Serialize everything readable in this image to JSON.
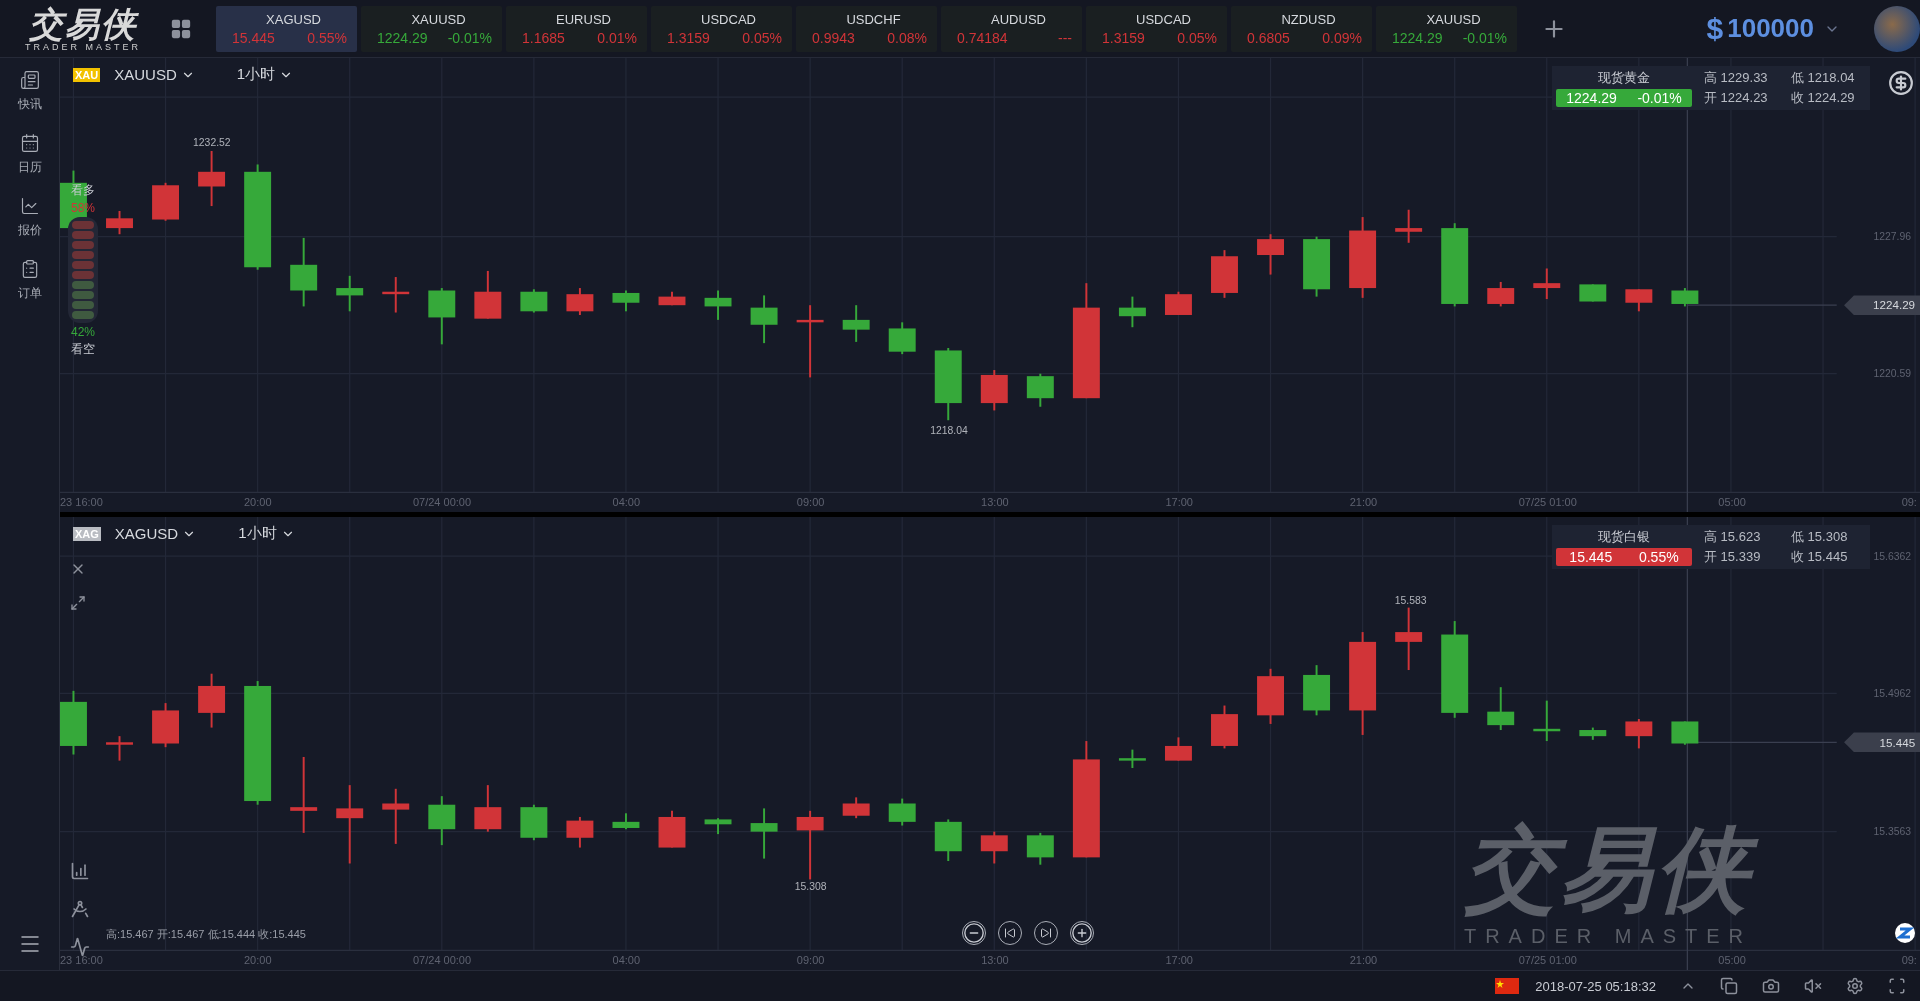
{
  "logo": {
    "name": "交易侠",
    "tagline": "TRADER MASTER"
  },
  "tickers": [
    {
      "symbol": "XAGUSD",
      "price": "15.445",
      "change": "0.55%",
      "color": "#d13438",
      "selected": true
    },
    {
      "symbol": "XAUUSD",
      "price": "1224.29",
      "change": "-0.01%",
      "color": "#36a93a",
      "selected": false
    },
    {
      "symbol": "EURUSD",
      "price": "1.1685",
      "change": "0.01%",
      "color": "#d13438",
      "selected": false
    },
    {
      "symbol": "USDCAD",
      "price": "1.3159",
      "change": "0.05%",
      "color": "#d13438",
      "selected": false
    },
    {
      "symbol": "USDCHF",
      "price": "0.9943",
      "change": "0.08%",
      "color": "#d13438",
      "selected": false
    },
    {
      "symbol": "AUDUSD",
      "price": "0.74184",
      "change": "---",
      "color": "#d13438",
      "selected": false
    },
    {
      "symbol": "USDCAD",
      "price": "1.3159",
      "change": "0.05%",
      "color": "#d13438",
      "selected": false
    },
    {
      "symbol": "NZDUSD",
      "price": "0.6805",
      "change": "0.09%",
      "color": "#d13438",
      "selected": false
    },
    {
      "symbol": "XAUUSD",
      "price": "1224.29",
      "change": "-0.01%",
      "color": "#36a93a",
      "selected": false
    }
  ],
  "balance": {
    "currency": "$",
    "amount": "100000"
  },
  "sidebar": {
    "items": [
      {
        "label": "快讯"
      },
      {
        "label": "日历"
      },
      {
        "label": "报价"
      },
      {
        "label": "订单"
      }
    ]
  },
  "charts": [
    {
      "badge": {
        "text": "XAU",
        "kind": "gold"
      },
      "symbol": "XAUUSD",
      "interval": "1小时",
      "info": {
        "name": "现货黄金",
        "price": "1224.29",
        "change": "-0.01%",
        "color": "#36a93a",
        "high": "高 1229.33",
        "low": "低 1218.04",
        "open": "开 1224.23",
        "close": "收 1224.29"
      },
      "sentiment": {
        "bull_label": "看多",
        "bull_percent": "58%",
        "level": 0.58,
        "bear_percent": "42%",
        "bear_label": "看空"
      },
      "price_axis": [
        "1227.96",
        "1220.59"
      ],
      "current_price": "1224.29",
      "high_marker": "1232.52",
      "low_marker": "1218.04",
      "time_axis": [
        "23 16:00",
        "20:00",
        "07/24 00:00",
        "04:00",
        "09:00",
        "13:00",
        "17:00",
        "21:00",
        "07/25 01:00",
        "05:00",
        "09:"
      ]
    },
    {
      "badge": {
        "text": "XAG",
        "kind": "silver"
      },
      "symbol": "XAGUSD",
      "interval": "1小时",
      "info": {
        "name": "现货白银",
        "price": "15.445",
        "change": "0.55%",
        "color": "#d13438",
        "high": "高 15.623",
        "low": "低 15.308",
        "open": "开 15.339",
        "close": "收 15.445"
      },
      "price_axis": [
        "15.6362",
        "15.4962",
        "15.3563"
      ],
      "current_price": "15.445",
      "high_marker": "15.583",
      "low_marker": "15.308",
      "time_axis": [
        "23 16:00",
        "20:00",
        "07/24 00:00",
        "04:00",
        "09:00",
        "13:00",
        "17:00",
        "21:00",
        "07/25 01:00",
        "05:00",
        "09:"
      ],
      "ohlc_line": "高:15.467 开:15.467 低:15.444 收:15.445",
      "watermark": {
        "name": "交易侠",
        "tagline": "TRADER MASTER"
      }
    }
  ],
  "status_bar": {
    "datetime": "2018-07-25 05:18:32"
  }
}
